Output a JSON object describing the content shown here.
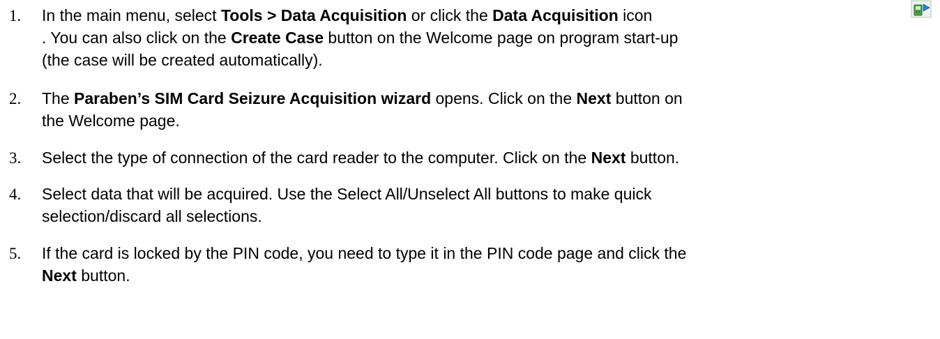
{
  "steps": [
    {
      "number": "1.",
      "lines": [
        [
          {
            "t": "In the main menu, select "
          },
          {
            "t": "Tools > Data Acquisition",
            "b": true
          },
          {
            "t": " or click the "
          },
          {
            "t": "Data Acquisition",
            "b": true
          },
          {
            "t": " icon"
          }
        ],
        [
          {
            "t": ". You can also click on the "
          },
          {
            "t": "Create Case",
            "b": true
          },
          {
            "t": " button on the Welcome page on program start-up"
          }
        ],
        [
          {
            "t": "(the case will be created automatically)."
          }
        ]
      ]
    },
    {
      "number": "2.",
      "lines": [
        [
          {
            "t": "The "
          },
          {
            "t": "Paraben’s SIM Card Seizure Acquisition wizard",
            "b": true
          },
          {
            "t": " opens. Click on the "
          },
          {
            "t": "Next",
            "b": true
          },
          {
            "t": " button on"
          }
        ],
        [
          {
            "t": "the Welcome page."
          }
        ]
      ]
    },
    {
      "number": "3.",
      "lines": [
        [
          {
            "t": "Select the type of connection of the card reader to the computer. Click on the "
          },
          {
            "t": "Next",
            "b": true
          },
          {
            "t": " button."
          }
        ]
      ]
    },
    {
      "number": "4.",
      "lines": [
        [
          {
            "t": "Select data that will be acquired. Use the Select All/Unselect All buttons to make quick"
          }
        ],
        [
          {
            "t": "selection/discard all selections."
          }
        ]
      ]
    },
    {
      "number": "5.",
      "lines": [
        [
          {
            "t": "If the card is locked by the PIN code, you need to type it in the PIN code page and click the"
          }
        ],
        [
          {
            "t": "Next",
            "b": true
          },
          {
            "t": " button."
          }
        ]
      ]
    }
  ],
  "icons": {
    "data_acquisition": "data-acquisition-icon"
  }
}
